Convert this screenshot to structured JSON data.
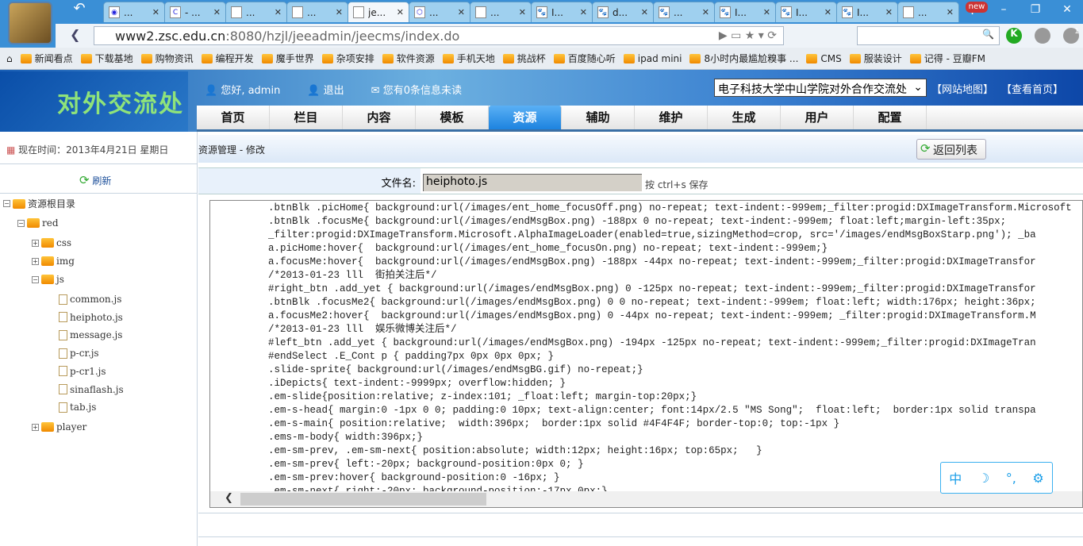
{
  "browser": {
    "tabs": [
      {
        "icon": "weibo-icon",
        "label": "..."
      },
      {
        "icon": "c-icon",
        "label": "- ..."
      },
      {
        "icon": "page-icon",
        "label": "..."
      },
      {
        "icon": "page-icon",
        "label": "..."
      },
      {
        "icon": "page-icon",
        "label": "je...",
        "active": true
      },
      {
        "icon": "hexagon-icon",
        "label": "..."
      },
      {
        "icon": "page-icon",
        "label": "..."
      },
      {
        "icon": "baidu-paw-icon",
        "label": "I..."
      },
      {
        "icon": "baidu-paw-icon",
        "label": "d..."
      },
      {
        "icon": "baidu-paw-icon",
        "label": "..."
      },
      {
        "icon": "baidu-paw-icon",
        "label": "I..."
      },
      {
        "icon": "baidu-paw-icon",
        "label": "I..."
      },
      {
        "icon": "baidu-paw-icon",
        "label": "I..."
      },
      {
        "icon": "page-icon",
        "label": "..."
      }
    ],
    "new_badge": "new",
    "url_host": "www2.zsc.edu.cn",
    "url_rest": ":8080/hzjl/jeeadmin/jeecms/index.do",
    "extension_badge": "1",
    "bookmarks": [
      "新闻看点",
      "下载基地",
      "购物资讯",
      "编程开发",
      "魔手世界",
      "杂项安排",
      "软件资源",
      "手机天地",
      "挑战杯",
      "百度随心听",
      "ipad mini",
      "8小时内最尴尬糗事 ...",
      "CMS",
      "服装设计",
      "记得 - 豆瓣FM"
    ]
  },
  "header": {
    "logo": "对外交流处",
    "greeting": "您好, admin",
    "logout": "退出",
    "messages": "您有0条信息未读",
    "site_select": "电子科技大学中山学院对外合作交流处",
    "sitemap": "【网站地图】",
    "view_home": "【查看首页】",
    "nav": [
      "首页",
      "栏目",
      "内容",
      "模板",
      "资源",
      "辅助",
      "维护",
      "生成",
      "用户",
      "配置"
    ],
    "active_nav": "资源"
  },
  "sidebar": {
    "clock": "现在时间：2013年4月21日  星期日",
    "refresh": "刷新",
    "tree": {
      "root": "资源根目录",
      "red": "red",
      "css": "css",
      "img": "img",
      "js": "js",
      "files": [
        "common.js",
        "heiphoto.js",
        "message.js",
        "p-cr.js",
        "p-cr1.js",
        "sinaflash.js",
        "tab.js"
      ],
      "player": "player"
    }
  },
  "main": {
    "breadcrumb": "资源管理 - 修改",
    "back_button": "返回列表",
    "filename_label": "文件名:",
    "filename_value": "heiphoto.js",
    "save_hint": "按  ctrl+s 保存",
    "code_lines": [
      ".btnBlk .picHome{ background:url(/images/ent_home_focusOff.png) no-repeat; text-indent:-999em;_filter:progid:DXImageTransform.Microsoft",
      ".btnBlk .focusMe{ background:url(/images/endMsgBox.png) -188px 0 no-repeat; text-indent:-999em; float:left;margin-left:35px;",
      "_filter:progid:DXImageTransform.Microsoft.AlphaImageLoader(enabled=true,sizingMethod=crop, src='/images/endMsgBoxStarp.png'); _ba",
      "a.picHome:hover{  background:url(/images/ent_home_focusOn.png) no-repeat; text-indent:-999em;}",
      "a.focusMe:hover{  background:url(/images/endMsgBox.png) -188px -44px no-repeat; text-indent:-999em;_filter:progid:DXImageTransfor",
      "/*2013-01-23 lll  街拍关注后*/",
      "#right_btn .add_yet { background:url(/images/endMsgBox.png) 0 -125px no-repeat; text-indent:-999em;_filter:progid:DXImageTransfor",
      ".btnBlk .focusMe2{ background:url(/images/endMsgBox.png) 0 0 no-repeat; text-indent:-999em; float:left; width:176px; height:36px;",
      "a.focusMe2:hover{  background:url(/images/endMsgBox.png) 0 -44px no-repeat; text-indent:-999em; _filter:progid:DXImageTransform.M",
      "/*2013-01-23 lll  娱乐微博关注后*/",
      "#left_btn .add_yet { background:url(/images/endMsgBox.png) -194px -125px no-repeat; text-indent:-999em;_filter:progid:DXImageTran",
      "#endSelect .E_Cont p { padding7px 0px 0px 0px; }",
      ".slide-sprite{ background:url(/images/endMsgBG.gif) no-repeat;}",
      ".iDepicts{ text-indent:-9999px; overflow:hidden; }",
      ".em-slide{position:relative; z-index:101; _float:left; margin-top:20px;}",
      ".em-s-head{ margin:0 -1px 0 0; padding:0 10px; text-align:center; font:14px/2.5 \"MS Song\";  float:left;  border:1px solid transpa",
      ".em-s-main{ position:relative;  width:396px;  border:1px solid #4F4F4F; border-top:0; top:-1px }",
      ".ems-m-body{ width:396px;}",
      ".em-sm-prev, .em-sm-next{ position:absolute; width:12px; height:16px; top:65px;   }",
      ".em-sm-prev{ left:-20px; background-position:0px 0; }",
      ".em-sm-prev:hover{ background-position:0 -16px; }",
      ".em-sm-next{ right:-20px; background-position:-17px 0px;}"
    ]
  },
  "ime": {
    "items": [
      "中",
      "☽",
      "°,",
      "⚙"
    ]
  }
}
